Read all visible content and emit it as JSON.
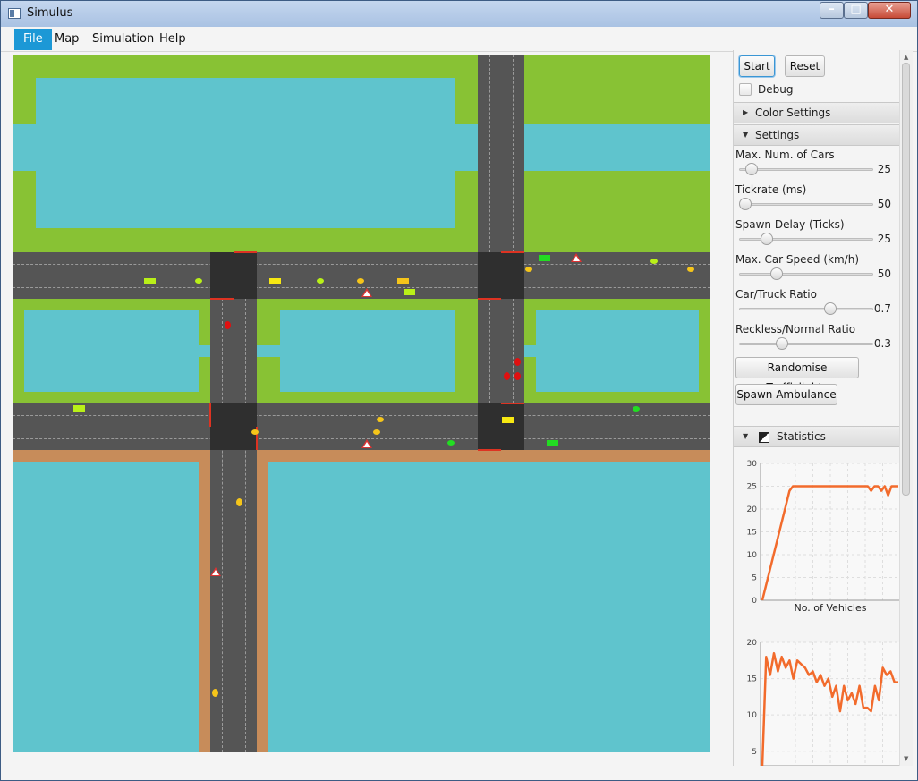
{
  "window": {
    "title": "Simulus"
  },
  "menu": {
    "items": [
      "File",
      "Map",
      "Simulation",
      "Help"
    ]
  },
  "controls": {
    "start_label": "Start",
    "reset_label": "Reset",
    "debug_label": "Debug",
    "debug_checked": false
  },
  "color_settings": {
    "title": "Color Settings",
    "expanded": false
  },
  "settings": {
    "title": "Settings",
    "expanded": true,
    "sliders": [
      {
        "label": "Max. Num. of Cars",
        "value": "25",
        "fraction": 0.05
      },
      {
        "label": "Tickrate (ms)",
        "value": "50",
        "fraction": 0.0
      },
      {
        "label": "Spawn Delay (Ticks)",
        "value": "25",
        "fraction": 0.18
      },
      {
        "label": "Max. Car Speed (km/h)",
        "value": "50",
        "fraction": 0.26
      },
      {
        "label": "Car/Truck Ratio",
        "value": "0.7",
        "fraction": 0.7
      },
      {
        "label": "Reckless/Normal Ratio",
        "value": "0.3",
        "fraction": 0.3
      }
    ],
    "randomise_label": "Randomise Trafficlights",
    "spawn_ambulance_label": "Spawn Ambulance"
  },
  "statistics": {
    "title": "Statistics"
  },
  "colors": {
    "line": "#f26b2c",
    "grass": "#88c234",
    "water": "#5fc4cd",
    "road": "#555555",
    "dirt": "#c78c5a"
  },
  "chart_data": [
    {
      "type": "line",
      "xlabel": "No. of Vehicles",
      "ylabel": "",
      "ylim": [
        0,
        30
      ],
      "yticks": [
        "0",
        "5",
        "10",
        "15",
        "20",
        "25",
        "30"
      ],
      "series": [
        {
          "values": [
            0,
            3,
            6,
            9,
            12,
            15,
            18,
            21,
            24,
            25,
            25,
            25,
            25,
            25,
            25,
            25,
            25,
            25,
            25,
            25,
            25,
            25,
            25,
            25,
            25,
            25,
            25,
            25,
            25,
            25,
            25,
            25,
            24,
            25,
            25,
            24,
            25,
            23,
            25,
            25,
            25
          ]
        }
      ]
    },
    {
      "type": "line",
      "xlabel": "",
      "ylabel": "",
      "ylim": [
        3,
        20
      ],
      "yticks": [
        "5",
        "10",
        "15",
        "20"
      ],
      "series": [
        {
          "values": [
            3,
            18,
            15.5,
            18.5,
            16,
            18,
            16.5,
            17.5,
            15,
            17.5,
            17,
            16.5,
            15.5,
            16,
            14.5,
            15.5,
            14,
            15,
            12.5,
            14,
            10.5,
            14,
            12,
            13,
            11.5,
            14,
            11,
            11,
            10.5,
            14,
            12,
            16.5,
            15.5,
            16,
            14.5,
            14.5
          ]
        }
      ]
    }
  ]
}
